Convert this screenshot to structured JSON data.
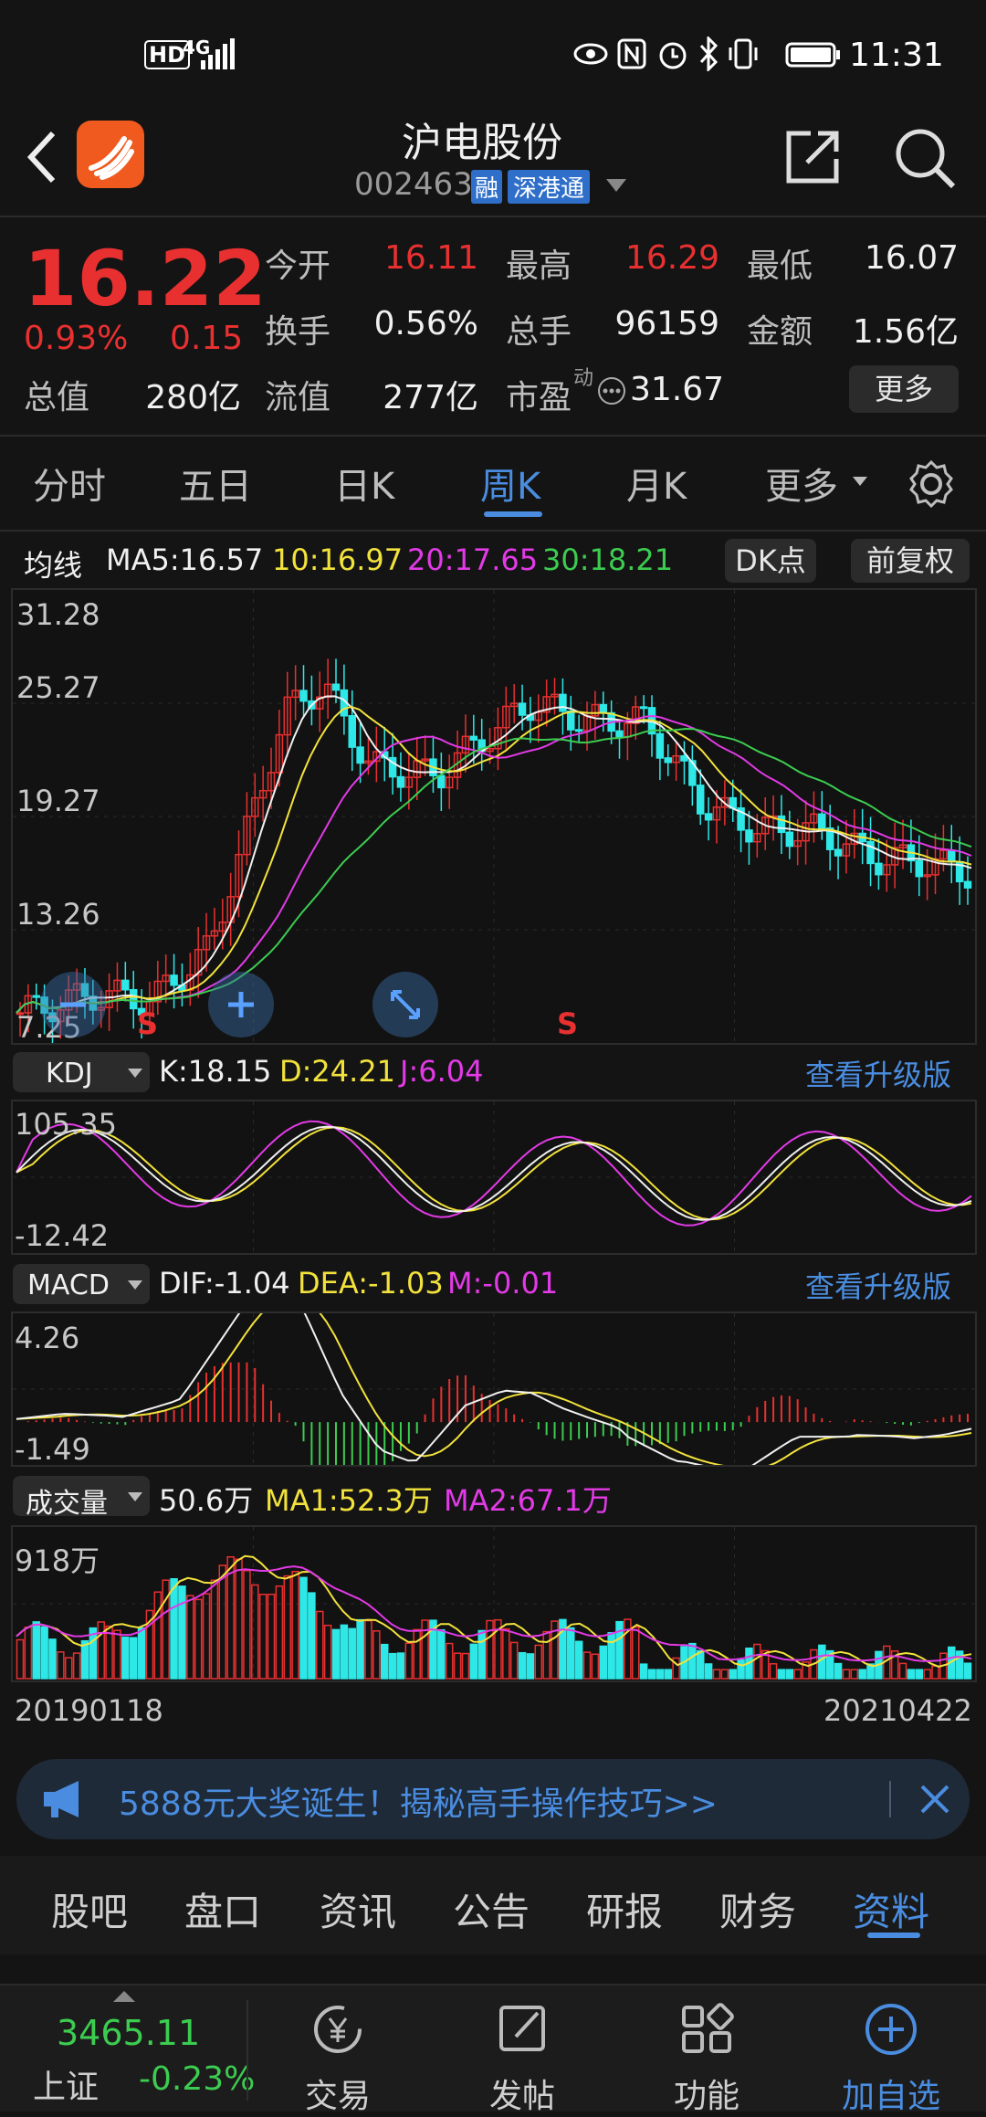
{
  "status": {
    "time": "11:31",
    "hd": "HD",
    "net": "4G"
  },
  "header": {
    "title": "沪电股份",
    "code": "002463",
    "badge_rong": "融",
    "badge_sgt": "深港通"
  },
  "quote": {
    "price": "16.22",
    "change_pct": "0.93%",
    "change": "0.15",
    "labels": {
      "open": "今开",
      "high": "最高",
      "low": "最低",
      "turnover": "换手",
      "volume": "总手",
      "amount": "金额",
      "mktcap": "总值",
      "float_cap": "流值",
      "pe": "市盈",
      "pe_sup": "动"
    },
    "open": "16.11",
    "high": "16.29",
    "low": "16.07",
    "turnover": "0.56%",
    "volume": "96159",
    "amount": "1.56亿",
    "mktcap": "280亿",
    "float_cap": "277亿",
    "pe": "31.67",
    "more": "更多"
  },
  "period_tabs": [
    "分时",
    "五日",
    "日K",
    "周K",
    "月K",
    "更多"
  ],
  "period_active": "周K",
  "ma": {
    "label": "均线",
    "ma5": "MA5:16.57",
    "ma10": "10:16.97",
    "ma20": "20:17.65",
    "ma30": "30:18.21",
    "dk": "DK点",
    "fq": "前复权"
  },
  "main_axis": [
    "31.28",
    "25.27",
    "19.27",
    "13.26",
    "7.25"
  ],
  "signals": [
    "S",
    "S"
  ],
  "kdj": {
    "name": "KDJ",
    "k": "K:18.15",
    "d": "D:24.21",
    "j": "J:6.04",
    "upgrade": "查看升级版",
    "max": "105.35",
    "min": "-12.42"
  },
  "macd": {
    "name": "MACD",
    "dif": "DIF:-1.04",
    "dea": "DEA:-1.03",
    "m": "M:-0.01",
    "upgrade": "查看升级版",
    "max": "4.26",
    "min": "-1.49"
  },
  "vol": {
    "name": "成交量",
    "value": "50.6万",
    "ma1": "MA1:52.3万",
    "ma2": "MA2:67.1万",
    "max": "918万"
  },
  "dates": {
    "start": "20190118",
    "end": "20210422"
  },
  "banner": {
    "text": "5888元大奖诞生！揭秘高手操作技巧>>"
  },
  "func_tabs": [
    "股吧",
    "盘口",
    "资讯",
    "公告",
    "研报",
    "财务",
    "资料"
  ],
  "func_active": "资料",
  "index": {
    "value": "3465.11",
    "name": "上证",
    "change": "-0.23%"
  },
  "bottom_nav": [
    "交易",
    "发帖",
    "功能",
    "加自选"
  ],
  "colors": {
    "up": "#e83030",
    "down": "#2ee8e8",
    "accent": "#4a8de0",
    "ma5": "#f0f0f0",
    "ma10": "#f2e23c",
    "ma20": "#e23ae6",
    "ma30": "#3ccc50"
  }
}
